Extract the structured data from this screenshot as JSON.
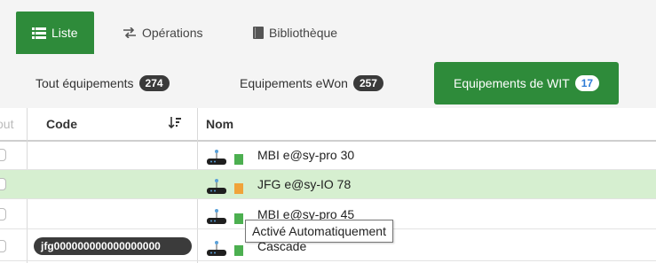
{
  "nav": {
    "tabs": [
      {
        "label": "Liste",
        "icon": "list-icon",
        "active": true
      },
      {
        "label": "Opérations",
        "icon": "swap-icon",
        "active": false
      },
      {
        "label": "Bibliothèque",
        "icon": "book-icon",
        "active": false
      }
    ]
  },
  "filters": [
    {
      "label": "Tout équipements",
      "count": "274",
      "active": false
    },
    {
      "label": "Equipements eWon",
      "count": "257",
      "active": false
    },
    {
      "label": "Equipements de WIT",
      "count": "17",
      "active": true
    }
  ],
  "table": {
    "partial_col": "out",
    "col_code": "Code",
    "col_name": "Nom",
    "sort_icon": "sort-desc-icon",
    "rows": [
      {
        "code": "",
        "name": "MBI e@sy-pro 30",
        "status_color": "#4caf50",
        "highlight": false
      },
      {
        "code": "",
        "name": "JFG e@sy-IO 78",
        "status_color": "#f0a33a",
        "highlight": true
      },
      {
        "code": "",
        "name": "MBI e@sy-pro 45",
        "status_color": "#4caf50",
        "highlight": false
      },
      {
        "code": "jfg000000000000000000",
        "name": "Cascade",
        "status_color": "#4caf50",
        "highlight": false
      }
    ]
  },
  "tooltip": "Activé Automatiquement",
  "colors": {
    "accent": "#2e8b3a",
    "highlight_row": "#d6efd0",
    "badge_active_text": "#2e7bd6"
  }
}
